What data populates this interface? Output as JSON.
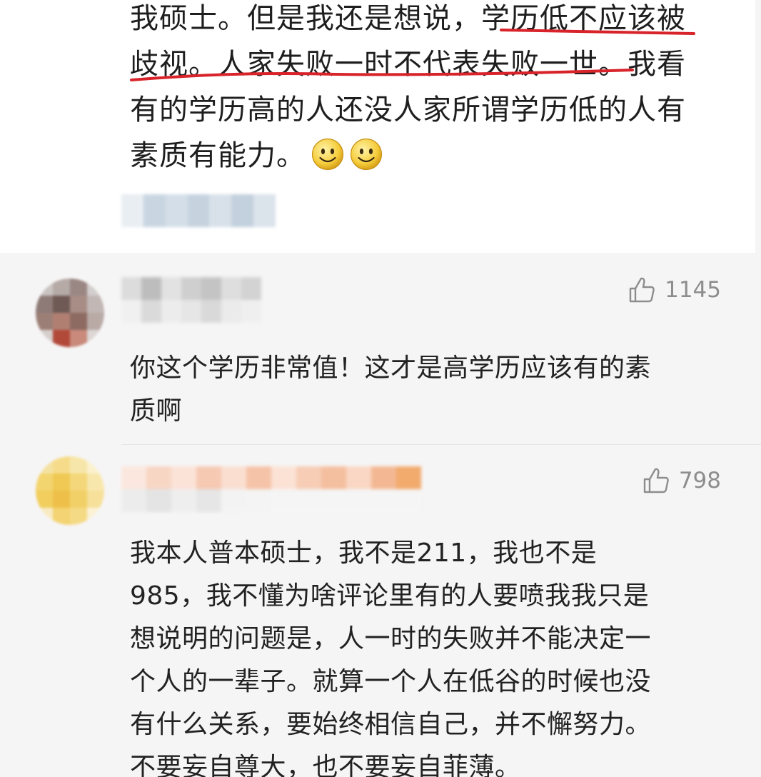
{
  "main_post": {
    "lines": [
      "我硕士。但是我还是想说，学历低不应该被",
      "歧视。人家失败一时不代表失败一世。我看",
      "有的学历高的人还没人家所谓学历低的人有",
      "素质有能力。"
    ],
    "emoji_name": "smile-emoji"
  },
  "comments": [
    {
      "like_count": "1145",
      "lines": [
        "你这个学历非常值！这才是高学历应该有的素",
        "质啊"
      ]
    },
    {
      "like_count": "798",
      "lines": [
        "我本人普本硕士，我不是211，我也不是",
        "985，我不懂为啥评论里有的人要喷我我只是",
        "想说明的问题是，人一时的失败并不能决定一",
        "个人的一辈子。就算一个人在低谷的时候也没",
        "有什么关系，要始终相信自己，并不懈努力。",
        "不要妄自尊大，也不要妄自菲薄。"
      ]
    }
  ],
  "colors": {
    "underline": "#d8232a",
    "like_gray": "#8d8d8d",
    "background": "#f6f5f5"
  }
}
